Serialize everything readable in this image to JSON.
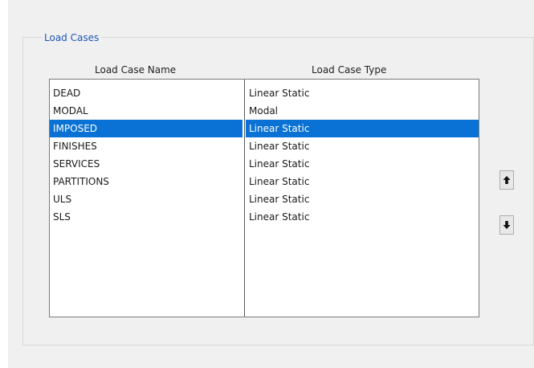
{
  "group": {
    "title": "Load Cases"
  },
  "columns": {
    "name_header": "Load Case Name",
    "type_header": "Load Case Type"
  },
  "load_cases": [
    {
      "name": "DEAD",
      "type": "Linear Static",
      "selected": false
    },
    {
      "name": "MODAL",
      "type": "Modal",
      "selected": false
    },
    {
      "name": "IMPOSED",
      "type": "Linear Static",
      "selected": true
    },
    {
      "name": "FINISHES",
      "type": "Linear Static",
      "selected": false
    },
    {
      "name": "SERVICES",
      "type": "Linear Static",
      "selected": false
    },
    {
      "name": "PARTITIONS",
      "type": "Linear Static",
      "selected": false
    },
    {
      "name": "ULS",
      "type": "Linear Static",
      "selected": false
    },
    {
      "name": "SLS",
      "type": "Linear Static",
      "selected": false
    }
  ],
  "buttons": {
    "move_up_icon": "arrow-up-icon",
    "move_down_icon": "arrow-down-icon"
  },
  "colors": {
    "selection": "#0a72d4",
    "group_title": "#1a55b8"
  }
}
